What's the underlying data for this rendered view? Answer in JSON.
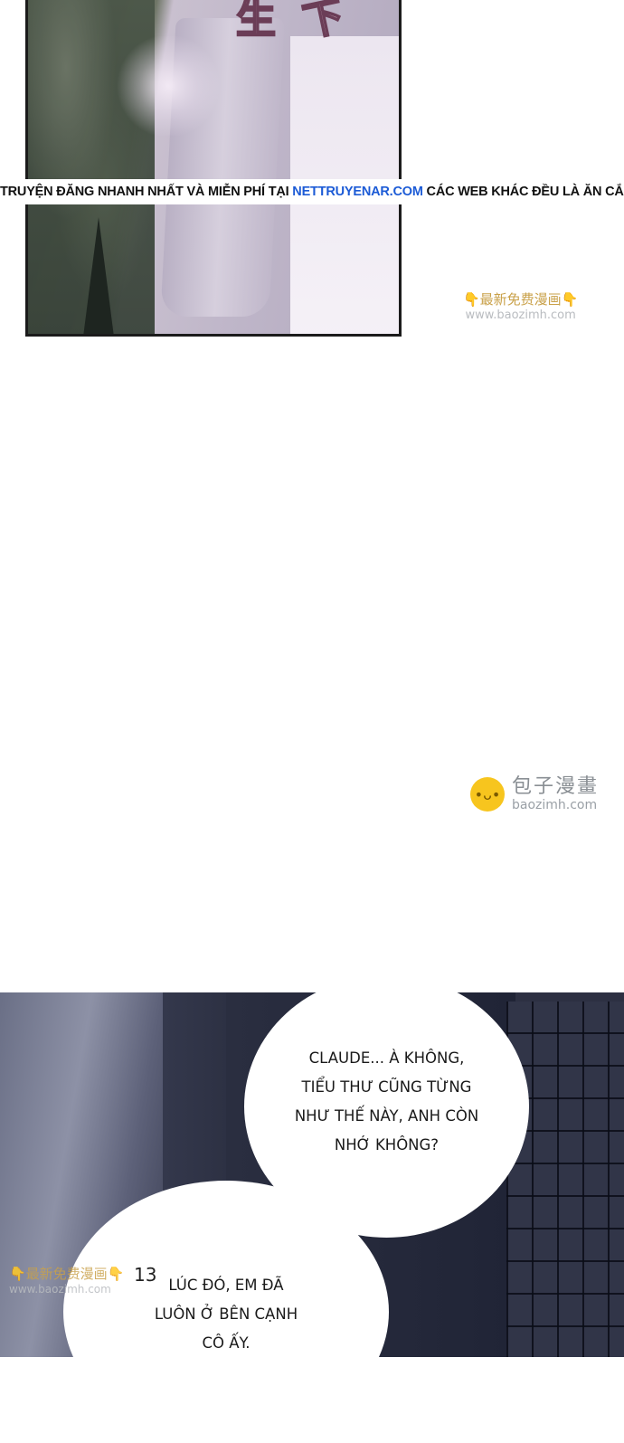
{
  "panel1": {
    "sfx_chars": [
      "生",
      "下"
    ]
  },
  "notice": {
    "before": "TRUYỆN ĐĂNG NHANH NHẤT VÀ MIỄN PHÍ TẠI ",
    "site": "NETTRUYENAR.COM",
    "after": " CÁC WEB KHÁC ĐỀU LÀ ĂN CẮP"
  },
  "watermark_small_1": {
    "text": "👇最新免费漫画👇",
    "url": "www.baozimh.com"
  },
  "watermark_big": {
    "icon": "•ᴗ•",
    "text": "包子漫畫",
    "url": "baozimh.com"
  },
  "bubble1": {
    "lines": [
      "CLAUDE... À KHÔNG,",
      "TIỂU THƯ CŨNG TỪNG",
      "NHƯ THẾ NÀY, ANH CÒN",
      "NHỚ KHÔNG?"
    ]
  },
  "bubble2": {
    "lines": [
      "LÚC ĐÓ, EM ĐÃ",
      "LUÔN Ở BÊN CẠNH",
      "CÔ ẤY."
    ]
  },
  "page_mark": "13",
  "watermark_small_2": {
    "text": "👇最新免费漫画👇",
    "url": "www.baozimh.com"
  }
}
